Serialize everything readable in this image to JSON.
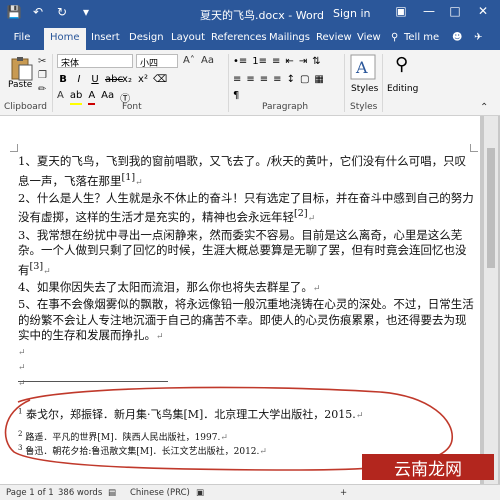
{
  "titlebar": {
    "title": "夏天的飞鸟.docx - Word",
    "signin": "Sign in",
    "qat": [
      "save-icon",
      "undo-icon",
      "redo-icon"
    ]
  },
  "tabs": [
    "File",
    "Home",
    "Insert",
    "Design",
    "Layout",
    "References",
    "Mailings",
    "Review",
    "View",
    "Tell me"
  ],
  "ribbon": {
    "paste": "Paste",
    "clipboard": "Clipboard",
    "font_name": "宋体",
    "font_size": "小四",
    "font": "Font",
    "paragraph": "Paragraph",
    "styles": "Styles",
    "styles_group": "Styles",
    "editing": "Editing"
  },
  "document": {
    "paragraphs": [
      "1、夏天的飞鸟，飞到我的窗前唱歌，又飞去了。/秋天的黄叶，它们没有什么可唱，只叹息一声，飞落在那里",
      "2、什么是人生？人生就是永不休止的奋斗！只有选定了目标，并在奋斗中感到自己的努力没有虚掷，这样的生活才是充实的，精神也会永远年轻",
      "3、我常想在纷扰中寻出一点闲静来，然而委实不容易。目前是这么离奇，心里是这么芜杂。一个人做到只剩了回忆的时候，生涯大概总要算是无聊了罢，但有时竟会连回忆也没有",
      "4、如果你因失去了太阳而流泪，那么你也将失去群星了。",
      "5、在事不会像烟雾似的飘散，将永远像铅一般沉重地浇铸在心灵的深处。不过，日常生活的纷繁不会让人专注地沉湎于自己的痛苦不幸。即使人的心灵伤痕累累，也还得要去为现实中的生存和发展而挣扎。"
    ],
    "refs": [
      "[1]",
      "[2]",
      "[3]"
    ],
    "footnotes": [
      "泰戈尔，郑振铎．新月集·飞鸟集[M]．北京理工大学出版社，2015.",
      "路遥．平凡的世界[M]．陕西人民出版社，1997.",
      "鲁迅．朝花夕拾:鲁迅散文集[M]．长江文艺出版社，2012."
    ],
    "footnote_nums": [
      "1",
      "2",
      "3"
    ]
  },
  "statusbar": {
    "page": "Page 1 of 1",
    "words": "386 words",
    "lang": "Chinese (PRC)",
    "zoom_percent": "+"
  },
  "watermark": "云南龙网",
  "colors": {
    "word_blue": "#2b579a",
    "annotation_red": "#c0392b"
  }
}
